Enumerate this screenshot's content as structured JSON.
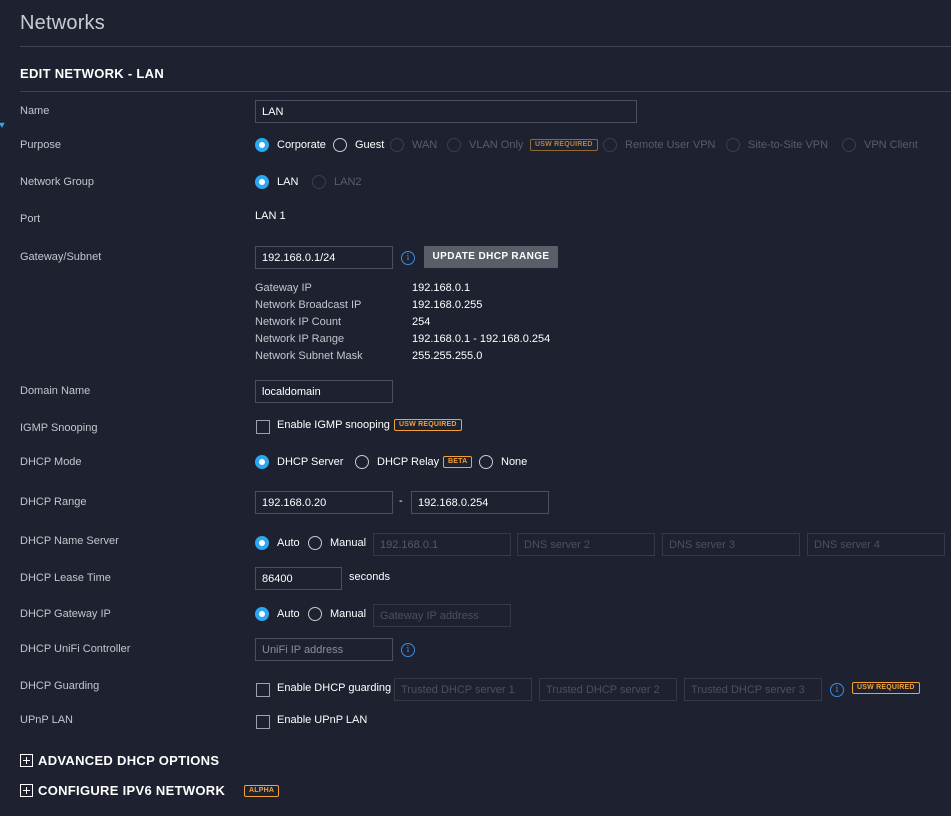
{
  "page_title": "Networks",
  "section_title": "EDIT NETWORK - LAN",
  "colors": {
    "accent": "#2ca7f0",
    "badge": "#f2a13a",
    "background": "#1e2130"
  },
  "name": {
    "label": "Name",
    "value": "LAN"
  },
  "purpose": {
    "label": "Purpose",
    "options": [
      "Corporate",
      "Guest",
      "WAN",
      "VLAN Only",
      "Remote User VPN",
      "Site-to-Site VPN",
      "VPN Client"
    ],
    "selected": "Corporate",
    "badge": "USW REQUIRED"
  },
  "network_group": {
    "label": "Network Group",
    "options": [
      "LAN",
      "LAN2"
    ],
    "selected": "LAN"
  },
  "port": {
    "label": "Port",
    "value": "LAN 1"
  },
  "gateway": {
    "label": "Gateway/Subnet",
    "value": "192.168.0.1/24",
    "button": "UPDATE DHCP RANGE",
    "info": [
      {
        "k": "Gateway IP",
        "v": "192.168.0.1"
      },
      {
        "k": "Network Broadcast IP",
        "v": "192.168.0.255"
      },
      {
        "k": "Network IP Count",
        "v": "254"
      },
      {
        "k": "Network IP Range",
        "v": "192.168.0.1 - 192.168.0.254"
      },
      {
        "k": "Network Subnet Mask",
        "v": "255.255.255.0"
      }
    ]
  },
  "domain": {
    "label": "Domain Name",
    "value": "localdomain"
  },
  "igmp": {
    "label": "IGMP Snooping",
    "checkbox_label": "Enable IGMP snooping",
    "checked": false,
    "badge": "USW REQUIRED"
  },
  "dhcp_mode": {
    "label": "DHCP Mode",
    "options": [
      "DHCP Server",
      "DHCP Relay",
      "None"
    ],
    "selected": "DHCP Server",
    "beta_badge": "BETA"
  },
  "dhcp_range": {
    "label": "DHCP Range",
    "start": "192.168.0.20",
    "separator": "-",
    "end": "192.168.0.254"
  },
  "dhcp_ns": {
    "label": "DHCP Name Server",
    "options": [
      "Auto",
      "Manual"
    ],
    "selected": "Auto",
    "fields": [
      "192.168.0.1",
      "DNS server 2",
      "DNS server 3",
      "DNS server 4"
    ]
  },
  "lease": {
    "label": "DHCP Lease Time",
    "value": "86400",
    "unit": "seconds"
  },
  "dhcp_gw": {
    "label": "DHCP Gateway IP",
    "options": [
      "Auto",
      "Manual"
    ],
    "selected": "Auto",
    "placeholder": "Gateway IP address"
  },
  "unifi": {
    "label": "DHCP UniFi Controller",
    "placeholder": "UniFi IP address"
  },
  "guarding": {
    "label": "DHCP Guarding",
    "checkbox_label": "Enable DHCP guarding",
    "checked": false,
    "fields": [
      "Trusted DHCP server 1",
      "Trusted DHCP server 2",
      "Trusted DHCP server 3"
    ],
    "badge": "USW REQUIRED"
  },
  "upnp": {
    "label": "UPnP LAN",
    "checkbox_label": "Enable UPnP LAN",
    "checked": false
  },
  "advanced_dhcp": {
    "label": "ADVANCED DHCP OPTIONS"
  },
  "ipv6": {
    "label": "CONFIGURE IPV6 NETWORK",
    "badge": "ALPHA"
  }
}
